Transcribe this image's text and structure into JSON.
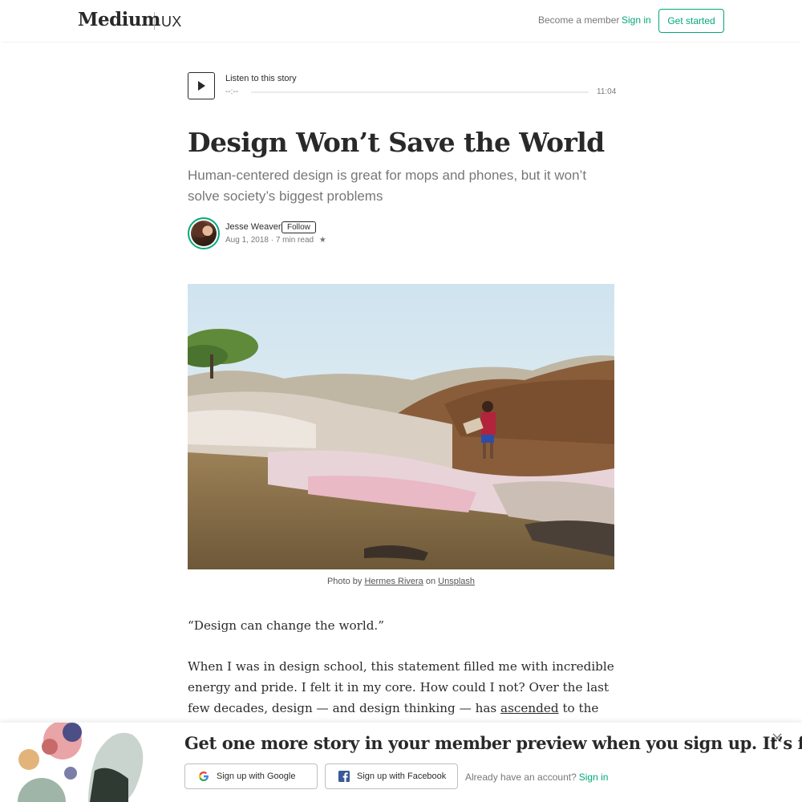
{
  "header": {
    "logo": "Medium",
    "publication": "UX",
    "become_member": "Become a member",
    "sign_in": "Sign in",
    "get_started": "Get started"
  },
  "audio": {
    "label": "Listen to this story",
    "current_time": "--:--",
    "duration": "11:04",
    "progress": 0
  },
  "article": {
    "title": "Design Won’t Save the World",
    "subtitle": "Human-centered design is great for mops and phones, but it won’t solve society’s biggest problems",
    "author": "Jesse Weaver",
    "follow": "Follow",
    "date": "Aug 1, 2018",
    "read_time": "7 min read",
    "star": "★",
    "caption_prefix": "Photo by",
    "caption_author": "Hermes Rivera",
    "caption_on": "on",
    "caption_source": "Unsplash",
    "paragraph1": "“Design can change the world.”",
    "paragraph2_before": "When I was in design school, this statement filled me with incredible energy and pride. I felt it in my core. How could I not? Over the last few decades, design — and design thinking — has",
    "paragraph2_link": "ascended",
    "paragraph2_after": "to the point of being"
  },
  "banner": {
    "title": "Get one more story in your member preview when you sign up. It’s free.",
    "google_button": "Sign up with Google",
    "facebook_button": "Sign up with Facebook",
    "already_text": "Already have an account?",
    "sign_in": "Sign in"
  },
  "colors": {
    "accent": "#03a87c",
    "facebook": "#3b5998"
  }
}
